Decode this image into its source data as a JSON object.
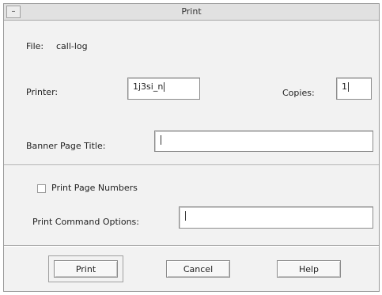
{
  "window": {
    "title": "Print",
    "menu_glyph": "–"
  },
  "file": {
    "label": "File:",
    "value": "call-log"
  },
  "printer": {
    "label": "Printer:",
    "value": "1j3si_n"
  },
  "copies": {
    "label": "Copies:",
    "value": "1"
  },
  "banner": {
    "label": "Banner Page Title:",
    "value": ""
  },
  "page_numbers": {
    "label": "Print Page Numbers",
    "checked": false
  },
  "command_options": {
    "label": "Print Command Options:",
    "value": ""
  },
  "buttons": {
    "print": "Print",
    "cancel": "Cancel",
    "help": "Help"
  }
}
